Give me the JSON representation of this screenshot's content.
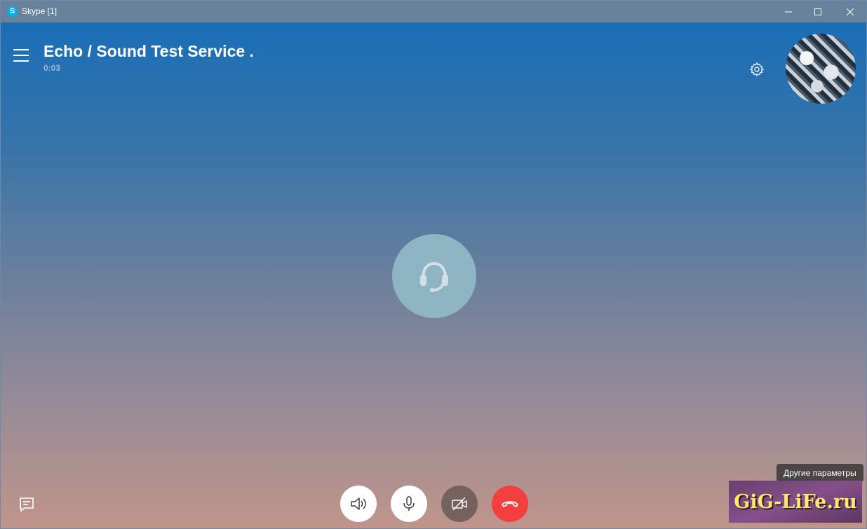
{
  "titlebar": {
    "logo_letter": "S",
    "title": "Skype [1]"
  },
  "call": {
    "contact_name": "Echo / Sound Test Service .",
    "timer": "0:03"
  },
  "tooltip": {
    "text": "Другие параметры"
  },
  "watermark": {
    "text": "GiG-LiFe.ru"
  },
  "colors": {
    "hangup": "#f3403f",
    "video_off": "#75625f",
    "skype_blue": "#00aff0"
  },
  "icons": {
    "menu": "hamburger-icon",
    "settings": "gear-icon",
    "center": "headset-icon",
    "chat": "chat-icon",
    "speaker": "speaker-icon",
    "mic": "microphone-icon",
    "video": "video-off-icon",
    "hangup": "hangup-icon"
  }
}
